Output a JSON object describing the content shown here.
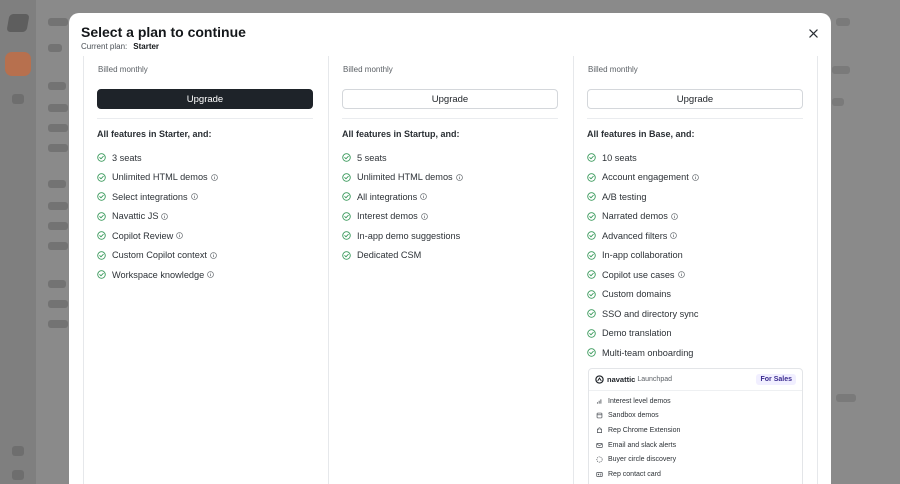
{
  "colors": {
    "accent_check": "#3a9a5c",
    "dark_button": "#1e2329",
    "for_sales": "#3a2a8f"
  },
  "modal": {
    "title": "Select a plan to continue",
    "current_plan_label": "Current plan:",
    "current_plan_value": "Starter",
    "close_icon": "close-icon"
  },
  "plans": [
    {
      "billed": "Billed monthly",
      "button": "Upgrade",
      "heading": "All features in Starter, and:",
      "features": [
        {
          "label": "3 seats",
          "info": false
        },
        {
          "label": "Unlimited HTML demos",
          "info": true
        },
        {
          "label": "Select integrations",
          "info": true
        },
        {
          "label": "Navattic JS",
          "info": true
        },
        {
          "label": "Copilot Review",
          "info": true
        },
        {
          "label": "Custom Copilot context",
          "info": true
        },
        {
          "label": "Workspace knowledge",
          "info": true
        }
      ]
    },
    {
      "billed": "Billed monthly",
      "button": "Upgrade",
      "heading": "All features in Startup, and:",
      "features": [
        {
          "label": "5 seats",
          "info": false
        },
        {
          "label": "Unlimited HTML demos",
          "info": true
        },
        {
          "label": "All integrations",
          "info": true
        },
        {
          "label": "Interest demos",
          "info": true
        },
        {
          "label": "In-app demo suggestions",
          "info": false
        },
        {
          "label": "Dedicated CSM",
          "info": false
        }
      ]
    },
    {
      "billed": "Billed monthly",
      "button": "Upgrade",
      "heading": "All features in Base, and:",
      "features": [
        {
          "label": "10 seats",
          "info": false
        },
        {
          "label": "Account engagement",
          "info": true
        },
        {
          "label": "A/B testing",
          "info": false
        },
        {
          "label": "Narrated demos",
          "info": true
        },
        {
          "label": "Advanced filters",
          "info": true
        },
        {
          "label": "In-app collaboration",
          "info": false
        },
        {
          "label": "Copilot use cases",
          "info": true
        },
        {
          "label": "Custom domains",
          "info": false
        },
        {
          "label": "SSO and directory sync",
          "info": false
        },
        {
          "label": "Demo translation",
          "info": false
        },
        {
          "label": "Multi-team onboarding",
          "info": false
        }
      ]
    }
  ],
  "launchpad": {
    "brand": "navattic",
    "product": "Launchpad",
    "badge": "For Sales",
    "items": [
      {
        "label": "Interest level demos",
        "icon": "bar-chart-icon"
      },
      {
        "label": "Sandbox demos",
        "icon": "box-icon"
      },
      {
        "label": "Rep Chrome Extension",
        "icon": "puzzle-icon"
      },
      {
        "label": "Email and slack alerts",
        "icon": "mail-icon"
      },
      {
        "label": "Buyer circle discovery",
        "icon": "circle-dashed-icon"
      },
      {
        "label": "Rep contact card",
        "icon": "id-card-icon"
      }
    ]
  }
}
